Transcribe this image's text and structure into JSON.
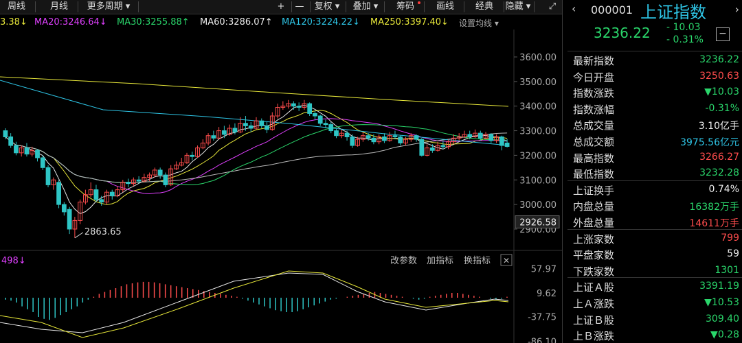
{
  "toolbar": {
    "items": [
      {
        "label": "周线",
        "name": "weekly-button"
      },
      {
        "label": "月线",
        "name": "monthly-button"
      },
      {
        "label": "更多周期 ▾",
        "name": "more-periods-dropdown"
      },
      {
        "label": "+",
        "name": "zoom-in-button"
      },
      {
        "label": "—",
        "name": "zoom-out-button"
      },
      {
        "label": "复权 ▾",
        "name": "adjust-dropdown"
      },
      {
        "label": "叠加 ▾",
        "name": "overlay-dropdown"
      },
      {
        "label": "筹码",
        "name": "chips-button"
      },
      {
        "label": "画线",
        "name": "draw-line-button"
      },
      {
        "label": "经典",
        "name": "classic-button"
      },
      {
        "label": "隐藏 ▾",
        "name": "hide-dropdown"
      }
    ]
  },
  "ma_bar": {
    "ma10": "3.38↓",
    "ma20": "MA20:3246.64↓",
    "ma30": "MA30:3255.88↑",
    "ma60": "MA60:3286.07↑",
    "ma120": "MA120:3224.22↓",
    "ma250": "MA250:3397.40↓",
    "settings": "设置均线 ▾"
  },
  "colors": {
    "up": "#ff4d4d",
    "down": "#2ec5c5",
    "ma5": "#e8e8e8",
    "ma10": "#e8e83a",
    "ma20": "#e040ff",
    "ma30": "#2ad66b",
    "ma60": "#bbbbbb",
    "ma120": "#2ec5e6",
    "ma250": "#e8e83a"
  },
  "price_axis": {
    "ticks": [
      "3600.00",
      "3500.00",
      "3400.00",
      "3300.00",
      "3200.00",
      "3100.00",
      "3000.00",
      "2900.00"
    ],
    "current_tag": "2926.58",
    "low_annotation": "2863.65"
  },
  "indicator": {
    "label": "498↓",
    "buttons": [
      {
        "label": "改参数",
        "name": "change-params-button"
      },
      {
        "label": "加指标",
        "name": "add-indicator-button"
      },
      {
        "label": "换指标",
        "name": "switch-indicator-button"
      }
    ],
    "close": "✕",
    "ticks": [
      "57.97",
      "9.62",
      "-37.75",
      "-86.10"
    ]
  },
  "quote": {
    "code": "000001",
    "name": "上证指数",
    "price": "3236.22",
    "change": "- 10.03",
    "change_pct": "- 0.31%",
    "collapse": "−",
    "rows": [
      {
        "label": "最新指数",
        "value": "3236.22",
        "cls": "g"
      },
      {
        "label": "今日开盘",
        "value": "3250.63",
        "cls": "r"
      },
      {
        "label": "指数涨跌",
        "value": "▼10.03",
        "cls": "g"
      },
      {
        "label": "指数涨幅",
        "value": "-0.31%",
        "cls": "g"
      },
      {
        "label": "总成交量",
        "value": "3.10亿手",
        "cls": "w"
      },
      {
        "label": "总成交额",
        "value": "3975.56亿元",
        "cls": "c"
      },
      {
        "label": "最高指数",
        "value": "3266.27",
        "cls": "r"
      },
      {
        "label": "最低指数",
        "value": "3232.28",
        "cls": "g"
      },
      {
        "label": "上证换手",
        "value": "0.74%",
        "cls": "w"
      },
      {
        "label": "内盘总量",
        "value": "16382万手",
        "cls": "g"
      },
      {
        "label": "外盘总量",
        "value": "14611万手",
        "cls": "r"
      },
      {
        "label": "上涨家数",
        "value": "799",
        "cls": "r"
      },
      {
        "label": "平盘家数",
        "value": "59",
        "cls": "w"
      },
      {
        "label": "下跌家数",
        "value": "1301",
        "cls": "g"
      },
      {
        "label": "上证Ａ股",
        "value": "3391.19",
        "cls": "g"
      },
      {
        "label": "上Ａ涨跌",
        "value": "▼10.53",
        "cls": "g"
      },
      {
        "label": "上证Ｂ股",
        "value": "309.40",
        "cls": "g"
      },
      {
        "label": "上Ｂ涨跌",
        "value": "▼0.28",
        "cls": "g"
      }
    ]
  }
}
